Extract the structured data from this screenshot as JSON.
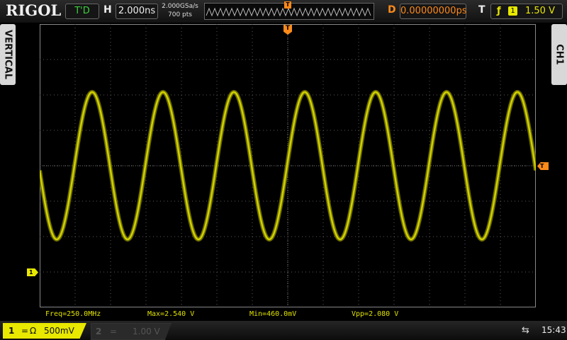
{
  "header": {
    "brand": "RIGOL",
    "run_status": "T'D",
    "timebase_label": "H",
    "timebase_value": "2.000ns",
    "sample_rate": "2.000GSa/s",
    "memory_depth": "700 pts",
    "delay_label": "D",
    "delay_value": "0.00000000ps",
    "trigger_label": "T",
    "trigger_channel": "1",
    "trigger_level": "1.50 V"
  },
  "side_tabs": {
    "left": "VERTICAL",
    "right": "CH1"
  },
  "measurements": {
    "freq": "Freq=250.0MHz",
    "max": "Max=2.540 V",
    "min": "Min=460.0mV",
    "vpp": "Vpp=2.080 V"
  },
  "channels": [
    {
      "number": "1",
      "coupling": "=",
      "impedance": "Ω",
      "scale": "500mV",
      "active": true,
      "color": "#e8e800"
    },
    {
      "number": "2",
      "coupling": "=",
      "impedance": "",
      "scale": "1.00 V",
      "active": false,
      "color": "#555555"
    }
  ],
  "markers": {
    "trigger_position": "T",
    "ch1_ground": "1",
    "trigger_level_marker": "T"
  },
  "clock": "15:43",
  "colors": {
    "waveform": "#d0d000",
    "accent": "#ff8a1a",
    "run_status": "#3ecf3e",
    "grid": "#5a5a5a"
  },
  "icons": {
    "trigger_edge": "rising-edge-icon",
    "usb": "usb-icon"
  }
}
